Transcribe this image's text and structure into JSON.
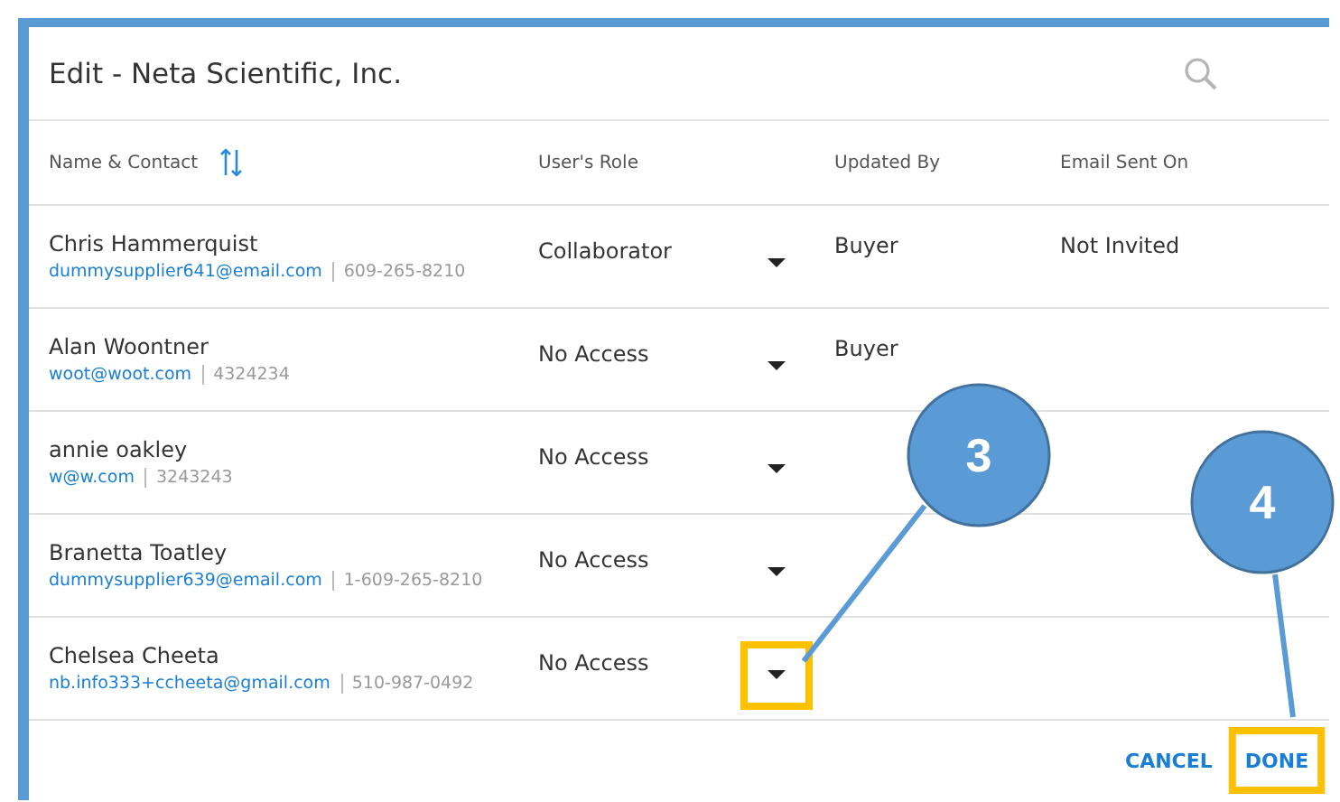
{
  "dialog": {
    "title": "Edit - Neta Scientific, Inc."
  },
  "table": {
    "columns": [
      {
        "label": "Name & Contact",
        "sortable": true
      },
      {
        "label": "User's Role",
        "sortable": false
      },
      {
        "label": "Updated By",
        "sortable": false
      },
      {
        "label": "Email Sent On",
        "sortable": false
      }
    ],
    "rows": [
      {
        "name": "Chris Hammerquist",
        "email": "dummysupplier641@email.com",
        "phone": "609-265-8210",
        "role": "Collaborator",
        "updated_by": "Buyer",
        "email_sent_on": "Not Invited"
      },
      {
        "name": "Alan Woontner",
        "email": "woot@woot.com",
        "phone": "4324234",
        "role": "No Access",
        "updated_by": "Buyer"
      },
      {
        "name": "annie oakley",
        "email": "w@w.com",
        "phone": "3243243",
        "role": "No Access"
      },
      {
        "name": "Branetta Toatley",
        "email": "dummysupplier639@email.com",
        "phone": "1-609-265-8210",
        "role": "No Access"
      },
      {
        "name": "Chelsea Cheeta",
        "email": "nb.info333+ccheeta@gmail.com",
        "phone": "510-987-0492",
        "role": "No Access"
      }
    ]
  },
  "buttons": [
    {
      "label": "CANCEL"
    },
    {
      "label": "DONE"
    }
  ],
  "callouts": [
    {
      "label": "3"
    },
    {
      "label": "4"
    }
  ]
}
